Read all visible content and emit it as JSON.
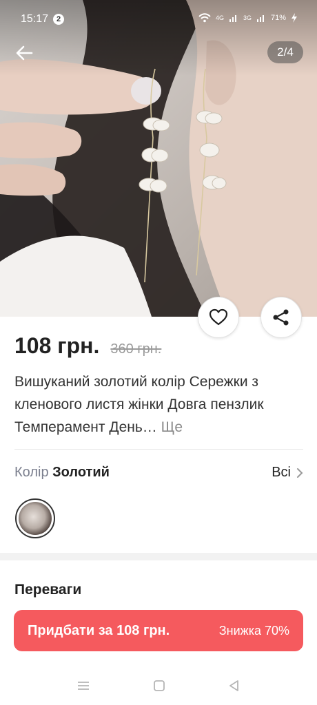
{
  "status_bar": {
    "time": "15:17",
    "notification_count": "2",
    "network_1": "4G",
    "network_2": "3G",
    "battery": "71%"
  },
  "gallery": {
    "counter": "2/4"
  },
  "product": {
    "price": "108 грн.",
    "old_price": "360 грн.",
    "title": "Вишуканий золотий колір Сережки з кленового листя жінки Довга пензлик Темперамент День…",
    "more_label": "Ще"
  },
  "variant": {
    "label": "Колір",
    "value": "Золотий",
    "all_label": "Всі"
  },
  "benefits": {
    "title": "Переваги"
  },
  "cta": {
    "buy_label": "Придбати за 108 грн.",
    "discount_label": "Знижка 70%",
    "color": "#f55a5e"
  },
  "icons": {
    "back": "arrow-left-icon",
    "favorite": "heart-icon",
    "share": "share-icon",
    "chevron": "chevron-right-icon",
    "nav_menu": "menu-icon",
    "nav_home": "square-home-icon",
    "nav_back": "triangle-back-icon"
  }
}
